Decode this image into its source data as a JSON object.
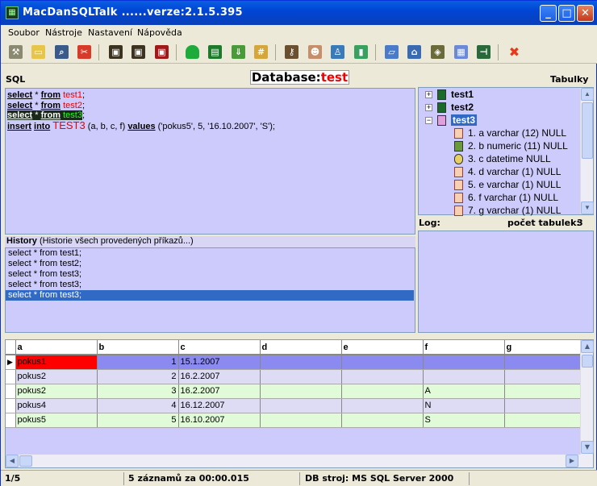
{
  "window": {
    "title": "MacDanSQLTalk ......verze:2.1.5.395"
  },
  "menu": [
    "Soubor",
    "Nástroje",
    "Nastavení",
    "Nápověda"
  ],
  "labels": {
    "sql": "SQL",
    "database_prefix": "Database:",
    "database_name": "test",
    "tables": "Tabulky",
    "log": "Log:",
    "table_count": "počet tabulek:",
    "table_count_value": "3"
  },
  "sql_lines": [
    {
      "kw1": "select",
      "rest1": " * ",
      "kw2": "from",
      "table": "test1",
      "rest2": ";"
    },
    {
      "kw1": "select",
      "rest1": " * ",
      "kw2": "from",
      "table": "test2",
      "rest2": ";"
    },
    {
      "kw1": "select",
      "rest1": " * ",
      "kw2": "from",
      "table": "test3",
      "rest2": ";"
    },
    {
      "kw1": "insert",
      "rest1": " ",
      "kw2": "into",
      "table": "TEST3",
      "rest2": " (a, b, c, f) ",
      "kw3": "values",
      "rest3": " ('pokus5', 5, '16.10.2007', 'S');"
    }
  ],
  "history": {
    "title": "History",
    "subtitle": "(Historie všech provedených příkazů...)",
    "items": [
      "select * from test1;",
      "select * from test2;",
      "select * from test3;",
      "select * from test3;",
      "select * from test3;"
    ],
    "selected_index": 4
  },
  "tree": {
    "tables": [
      "test1",
      "test2",
      "test3"
    ],
    "expanded": "test3",
    "columns": [
      "1. a varchar (12) NULL",
      "2. b numeric (11) NULL",
      "3. c datetime NULL",
      "4. d varchar (1) NULL",
      "5. e varchar (1) NULL",
      "6. f varchar (1) NULL",
      "7. g varchar (1) NULL"
    ]
  },
  "grid": {
    "columns": [
      "a",
      "b",
      "c",
      "d",
      "e",
      "f",
      "g"
    ],
    "rows": [
      [
        "pokus1",
        "1",
        "15.1.2007",
        "",
        "",
        "",
        ""
      ],
      [
        "pokus2",
        "2",
        "16.2.2007",
        "",
        "",
        "",
        ""
      ],
      [
        "pokus2",
        "3",
        "16.2.2007",
        "",
        "",
        "A",
        ""
      ],
      [
        "pokus4",
        "4",
        "16.12.2007",
        "",
        "",
        "N",
        ""
      ],
      [
        "pokus5",
        "5",
        "16.10.2007",
        "",
        "",
        "S",
        ""
      ]
    ]
  },
  "status": {
    "position": "1/5",
    "records": "5 záznamů za 00:00.015",
    "engine": "DB stroj: MS SQL Server 2000"
  },
  "colors": {
    "panel_bg": "#cccbfb",
    "row_green": "#e1fbd9",
    "row_lavender": "#dedcf5",
    "row_selected": "#8a8af0",
    "cell_red": "#ff0000",
    "history_selected": "#316ac5"
  }
}
